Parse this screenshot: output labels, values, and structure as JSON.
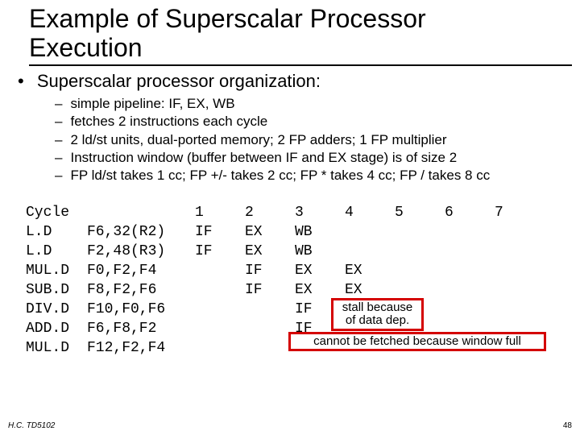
{
  "title_line1": "Example of Superscalar Processor",
  "title_line2": "Execution",
  "heading": "Superscalar processor organization:",
  "sub": [
    "simple pipeline: IF, EX, WB",
    "fetches 2 instructions each cycle",
    "2 ld/st units, dual-ported memory; 2 FP adders; 1 FP multiplier",
    "Instruction window (buffer between IF and EX stage) is of size 2",
    "FP ld/st takes 1 cc; FP +/- takes 2 cc; FP * takes 4 cc; FP / takes 8 cc"
  ],
  "table": {
    "header": {
      "label": "Cycle",
      "cols": [
        "1",
        "2",
        "3",
        "4",
        "5",
        "6",
        "7"
      ]
    },
    "rows": [
      {
        "instr": "L.D",
        "ops": "F6,32(R2)",
        "cells": [
          "IF",
          "EX",
          "WB",
          "",
          "",
          "",
          ""
        ]
      },
      {
        "instr": "L.D",
        "ops": "F2,48(R3)",
        "cells": [
          "IF",
          "EX",
          "WB",
          "",
          "",
          "",
          ""
        ]
      },
      {
        "instr": "MUL.D",
        "ops": "F0,F2,F4",
        "cells": [
          "",
          "IF",
          "EX",
          "EX",
          "",
          "",
          ""
        ]
      },
      {
        "instr": "SUB.D",
        "ops": "F8,F2,F6",
        "cells": [
          "",
          "IF",
          "EX",
          "EX",
          "",
          "",
          ""
        ]
      },
      {
        "instr": "DIV.D",
        "ops": "F10,F0,F6",
        "cells": [
          "",
          "",
          "IF",
          "",
          "",
          "",
          ""
        ]
      },
      {
        "instr": "ADD.D",
        "ops": "F6,F8,F2",
        "cells": [
          "",
          "",
          "IF",
          "",
          "",
          "",
          ""
        ]
      },
      {
        "instr": "MUL.D",
        "ops": "F12,F2,F4",
        "cells": [
          "",
          "",
          "",
          "",
          "",
          "",
          ""
        ]
      }
    ]
  },
  "annot": {
    "stall_l1": "stall because",
    "stall_l2": "of data dep.",
    "window": "cannot be fetched because window full"
  },
  "footer_left": "H.C. TD5102",
  "footer_right": "48"
}
